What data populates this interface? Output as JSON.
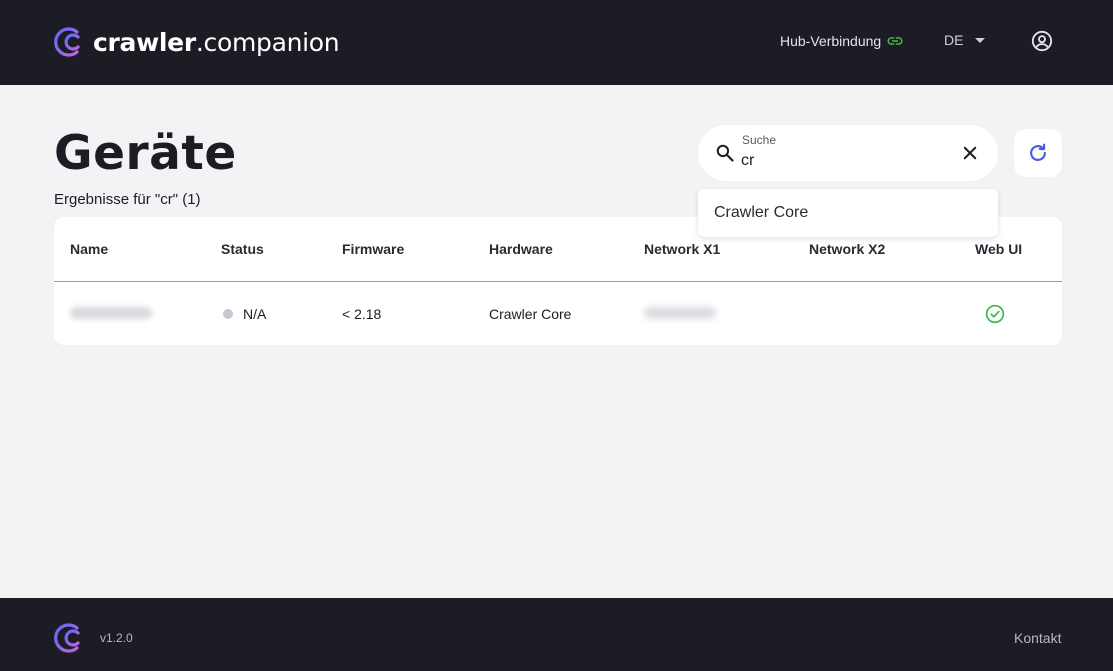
{
  "header": {
    "brand_bold": "crawler",
    "brand_rest": ".companion",
    "hub_label": "Hub-Verbindung",
    "language": "DE"
  },
  "page": {
    "title": "Geräte",
    "results": "Ergebnisse für \"cr\" (1)"
  },
  "search": {
    "label": "Suche",
    "value": "cr",
    "suggestions": [
      "Crawler Core"
    ]
  },
  "table": {
    "columns": [
      "Name",
      "Status",
      "Firmware",
      "Hardware",
      "Network X1",
      "Network X2",
      "Web UI"
    ],
    "rows": [
      {
        "status": "N/A",
        "firmware": "< 2.18",
        "hardware": "Crawler Core",
        "webui_icon": "check-circle-icon"
      }
    ]
  },
  "footer": {
    "version": "v1.2.0",
    "contact": "Kontakt"
  },
  "colors": {
    "header_bg": "#1c1c24",
    "page_bg": "#f3f3f6",
    "accent_blue": "#4a5cf0",
    "hub_green": "#4cc04c",
    "success_green": "#3cb84a",
    "logo_gradient": [
      "#5b6cf5",
      "#c064e8"
    ]
  }
}
